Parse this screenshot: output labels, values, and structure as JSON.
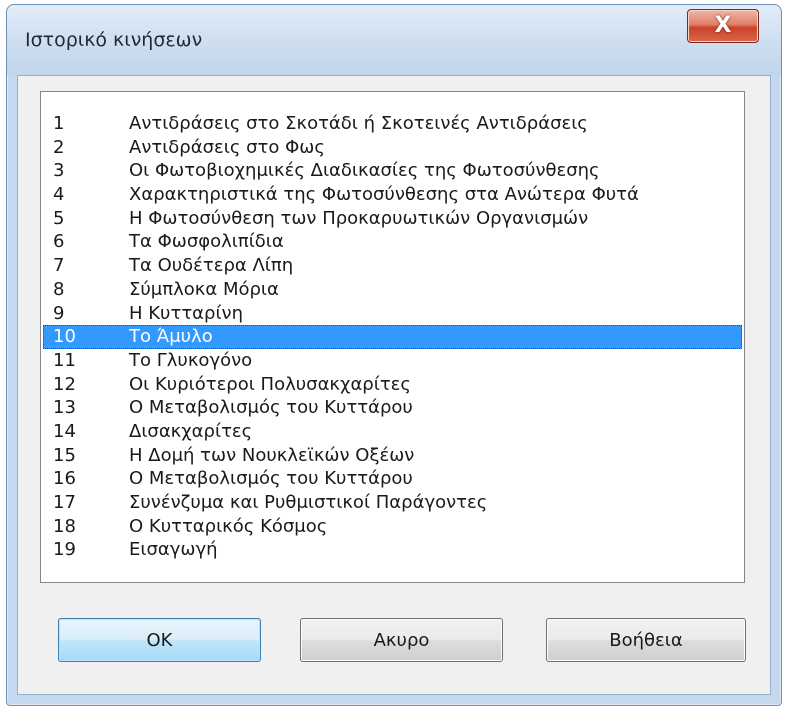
{
  "dialog": {
    "title": "Ιστορικό κινήσεων",
    "close_label": "X"
  },
  "list": {
    "selected_index": 9,
    "items": [
      {
        "num": "1",
        "label": "Αντιδράσεις στο Σκοτάδι ή Σκοτεινές Αντιδράσεις"
      },
      {
        "num": "2",
        "label": "Αντιδράσεις στο Φως"
      },
      {
        "num": "3",
        "label": "Οι Φωτοβιοχημικές Διαδικασίες της Φωτοσύνθεσης"
      },
      {
        "num": "4",
        "label": "Χαρακτηριστικά της Φωτοσύνθεσης στα Ανώτερα Φυτά"
      },
      {
        "num": "5",
        "label": "Η Φωτοσύνθεση των Προκαρυωτικών Οργανισμών"
      },
      {
        "num": "6",
        "label": "Τα Φωσφολιπίδια"
      },
      {
        "num": "7",
        "label": "Τα Ουδέτερα Λίπη"
      },
      {
        "num": "8",
        "label": "Σύμπλοκα Μόρια"
      },
      {
        "num": "9",
        "label": "Η Κυτταρίνη"
      },
      {
        "num": "10",
        "label": "Το Άμυλο"
      },
      {
        "num": "11",
        "label": "Το Γλυκογόνο"
      },
      {
        "num": "12",
        "label": "Οι Κυριότεροι Πολυσακχαρίτες"
      },
      {
        "num": "13",
        "label": "Ο Μεταβολισμός του Κυττάρου"
      },
      {
        "num": "14",
        "label": "Δισακχαρίτες"
      },
      {
        "num": "15",
        "label": "Η Δομή των Νουκλεϊκών Οξέων"
      },
      {
        "num": "16",
        "label": "Ο Μεταβολισμός του Κυττάρου"
      },
      {
        "num": "17",
        "label": "Συνένζυμα και Ρυθμιστικοί Παράγοντες"
      },
      {
        "num": "18",
        "label": "Ο Κυτταρικός Κόσμος"
      },
      {
        "num": "19",
        "label": "Εισαγωγή"
      }
    ]
  },
  "buttons": {
    "ok": "OK",
    "cancel": "Ακυρο",
    "help": "Βοήθεια"
  }
}
